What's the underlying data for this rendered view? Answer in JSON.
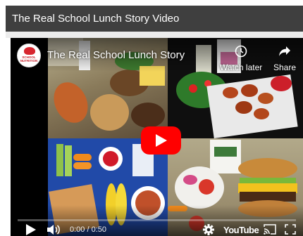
{
  "page": {
    "header_title": "The Real School Lunch Story Video"
  },
  "player": {
    "title": "The Real School Lunch Story",
    "channel_logo_text": "SCHOOL NUTRITION",
    "watch_later_label": "Watch later",
    "share_label": "Share",
    "time_display": "0:00 / 0:50",
    "brand_word": "YouTube",
    "progress_fraction": 0
  },
  "icons": [
    "clock-icon",
    "share-arrow-icon",
    "youtube-play-button",
    "play-icon",
    "volume-icon",
    "gear-icon",
    "cast-icon",
    "fullscreen-icon"
  ],
  "colors": {
    "header_bg": "#3f3f3f",
    "play_red": "#ff0000",
    "player_bg": "#000000"
  }
}
